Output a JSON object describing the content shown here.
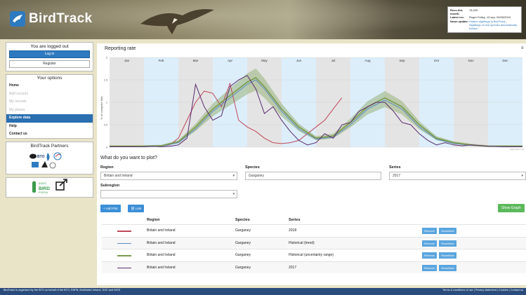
{
  "header": {
    "app_name": "BirdTrack",
    "news": [
      {
        "key": "Recs this month:",
        "value": "78,309"
      },
      {
        "key": "Latest rec:",
        "value": "Roger Feltey, 13 sep, 09/09/2019"
      },
      {
        "key": "News update:",
        "value": "Hidden sightings in BirdTrack - Sightings of rare species automatically hidden"
      }
    ]
  },
  "sidebar": {
    "login_status": "You are logged out",
    "login_button": "Log in",
    "register_button": "Register",
    "options_title": "Your options",
    "menu": [
      {
        "label": "Home",
        "state": "normal"
      },
      {
        "label": "Add records",
        "state": "disabled"
      },
      {
        "label": "My records",
        "state": "disabled"
      },
      {
        "label": "My places",
        "state": "disabled"
      },
      {
        "label": "Explore data",
        "state": "active"
      },
      {
        "label": "Help",
        "state": "normal"
      },
      {
        "label": "Contact us",
        "state": "normal"
      }
    ],
    "partners_title": "BirdTrack Partners",
    "partner_bto": "BTO",
    "ebp_line1": "EURO",
    "ebp_line2": "BIRD",
    "ebp_line3": "PORTAL"
  },
  "chart": {
    "title": "Reporting rate",
    "menu_icon": "≡",
    "ylabel": "% of complete lists"
  },
  "chart_data": {
    "type": "line",
    "title": "Reporting rate",
    "ylabel": "% of complete lists",
    "xlabel": "",
    "categories": [
      "Jan",
      "Feb",
      "Mar",
      "Apr",
      "May",
      "Jun",
      "Jul",
      "Aug",
      "Sep",
      "Oct",
      "Nov",
      "Dec"
    ],
    "ylim": [
      0,
      2
    ],
    "yticks": [
      "0",
      "0.5",
      "1",
      "1.5",
      "2"
    ],
    "credit": "Highcharts.com",
    "series": [
      {
        "name": "2018",
        "color": "#c0485a",
        "points": [
          [
            0,
            0.01
          ],
          [
            1,
            0.01
          ],
          [
            2,
            0.01
          ],
          [
            3,
            0.01
          ],
          [
            4,
            0.02
          ],
          [
            5,
            0.02
          ],
          [
            6,
            0.03
          ],
          [
            7,
            0.05
          ],
          [
            8,
            0.2
          ],
          [
            9,
            0.6
          ],
          [
            10,
            1.0
          ],
          [
            11,
            1.25
          ],
          [
            12,
            1.2
          ],
          [
            13,
            0.9
          ],
          [
            14,
            1.42
          ],
          [
            15,
            0.6
          ],
          [
            16,
            0.45
          ],
          [
            17,
            0.35
          ],
          [
            18,
            0.2
          ],
          [
            19,
            0.1
          ],
          [
            20,
            0.08
          ],
          [
            21,
            0.1
          ],
          [
            22,
            0.15
          ],
          [
            23,
            0.3
          ],
          [
            24,
            0.45
          ],
          [
            25,
            0.6
          ],
          [
            26,
            0.85
          ],
          [
            27,
            1.1
          ]
        ]
      },
      {
        "name": "Historical (trend)",
        "color": "#5b8cc2",
        "points": [
          [
            0,
            0.01
          ],
          [
            2,
            0.01
          ],
          [
            4,
            0.01
          ],
          [
            6,
            0.02
          ],
          [
            8,
            0.1
          ],
          [
            10,
            0.4
          ],
          [
            12,
            0.8
          ],
          [
            14,
            1.1
          ],
          [
            16,
            1.4
          ],
          [
            17,
            1.5
          ],
          [
            18,
            1.3
          ],
          [
            20,
            0.8
          ],
          [
            22,
            0.4
          ],
          [
            24,
            0.18
          ],
          [
            26,
            0.22
          ],
          [
            28,
            0.5
          ],
          [
            30,
            0.85
          ],
          [
            32,
            1.05
          ],
          [
            34,
            0.85
          ],
          [
            36,
            0.45
          ],
          [
            38,
            0.18
          ],
          [
            40,
            0.08
          ],
          [
            42,
            0.04
          ],
          [
            44,
            0.02
          ],
          [
            46,
            0.01
          ],
          [
            48,
            0.01
          ]
        ]
      },
      {
        "name": "Historical (uncertainty range)",
        "color": "#7a9a4a",
        "points": [
          [
            0,
            0.02
          ],
          [
            2,
            0.02
          ],
          [
            4,
            0.02
          ],
          [
            6,
            0.03
          ],
          [
            8,
            0.12
          ],
          [
            10,
            0.45
          ],
          [
            12,
            0.85
          ],
          [
            14,
            1.15
          ],
          [
            16,
            1.45
          ],
          [
            17,
            1.55
          ],
          [
            18,
            1.35
          ],
          [
            20,
            0.85
          ],
          [
            22,
            0.45
          ],
          [
            24,
            0.2
          ],
          [
            26,
            0.25
          ],
          [
            28,
            0.55
          ],
          [
            30,
            0.9
          ],
          [
            32,
            1.1
          ],
          [
            34,
            0.9
          ],
          [
            36,
            0.5
          ],
          [
            38,
            0.2
          ],
          [
            40,
            0.1
          ],
          [
            42,
            0.05
          ],
          [
            44,
            0.02
          ],
          [
            46,
            0.02
          ],
          [
            48,
            0.02
          ]
        ]
      },
      {
        "name": "2017",
        "color": "#5a2a6e",
        "points": [
          [
            0,
            0.01
          ],
          [
            2,
            0.01
          ],
          [
            4,
            0.01
          ],
          [
            5,
            0.02
          ],
          [
            6,
            0.01
          ],
          [
            7,
            0.02
          ],
          [
            8,
            0.05
          ],
          [
            9,
            0.2
          ],
          [
            10,
            1.4
          ],
          [
            11,
            0.9
          ],
          [
            12,
            0.6
          ],
          [
            13,
            0.7
          ],
          [
            14,
            1.35
          ],
          [
            15,
            1.5
          ],
          [
            16,
            1.6
          ],
          [
            17,
            1.3
          ],
          [
            18,
            0.75
          ],
          [
            19,
            0.9
          ],
          [
            20,
            0.6
          ],
          [
            21,
            0.35
          ],
          [
            22,
            0.15
          ],
          [
            23,
            0.05
          ],
          [
            24,
            0.1
          ],
          [
            25,
            0.3
          ],
          [
            26,
            0.2
          ],
          [
            27,
            0.5
          ],
          [
            28,
            0.55
          ],
          [
            29,
            0.8
          ],
          [
            30,
            0.9
          ],
          [
            31,
            1.0
          ],
          [
            32,
            1.0
          ],
          [
            33,
            0.8
          ],
          [
            34,
            0.55
          ],
          [
            35,
            0.5
          ],
          [
            36,
            0.3
          ],
          [
            37,
            0.15
          ],
          [
            38,
            0.05
          ],
          [
            39,
            0.1
          ],
          [
            40,
            0.05
          ],
          [
            41,
            0.03
          ],
          [
            42,
            0.05
          ],
          [
            44,
            0.02
          ],
          [
            46,
            0.01
          ],
          [
            48,
            0.01
          ]
        ]
      }
    ]
  },
  "plot_form": {
    "question": "What do you want to plot?",
    "region_label": "Region",
    "region_value": "Britain and Ireland",
    "species_label": "Species",
    "species_value": "Garganey",
    "series_label": "Series",
    "series_value": "2017",
    "subregion_label": "Subregion",
    "subregion_value": "",
    "add_plot": "+ Add Plot",
    "link": "Link",
    "show_graph": "Show Graph"
  },
  "table": {
    "headers": [
      "Region",
      "Species",
      "Series"
    ],
    "rows": [
      {
        "color": "#c0485a",
        "region": "Britain and Ireland",
        "species": "Garganey",
        "series": "2018"
      },
      {
        "color": "#5b8cc2",
        "region": "Britain and Ireland",
        "species": "Garganey",
        "series": "Historical (trend)"
      },
      {
        "color": "#7a9a4a",
        "region": "Britain and Ireland",
        "species": "Garganey",
        "series": "Historical (uncertainty range)"
      },
      {
        "color": "#5a2a6e",
        "region": "Britain and Ireland",
        "species": "Garganey",
        "series": "2017"
      }
    ],
    "remove_label": "Remove",
    "showhide_label": "Show/hide"
  },
  "footer": {
    "left": "BirdTrack is organised by the BTO on behalf of the BTO, RSPB, BirdWatch Ireland, SOC and WOS",
    "right": "Terms & conditions of use | Privacy statement | Cookies | Contact us"
  }
}
